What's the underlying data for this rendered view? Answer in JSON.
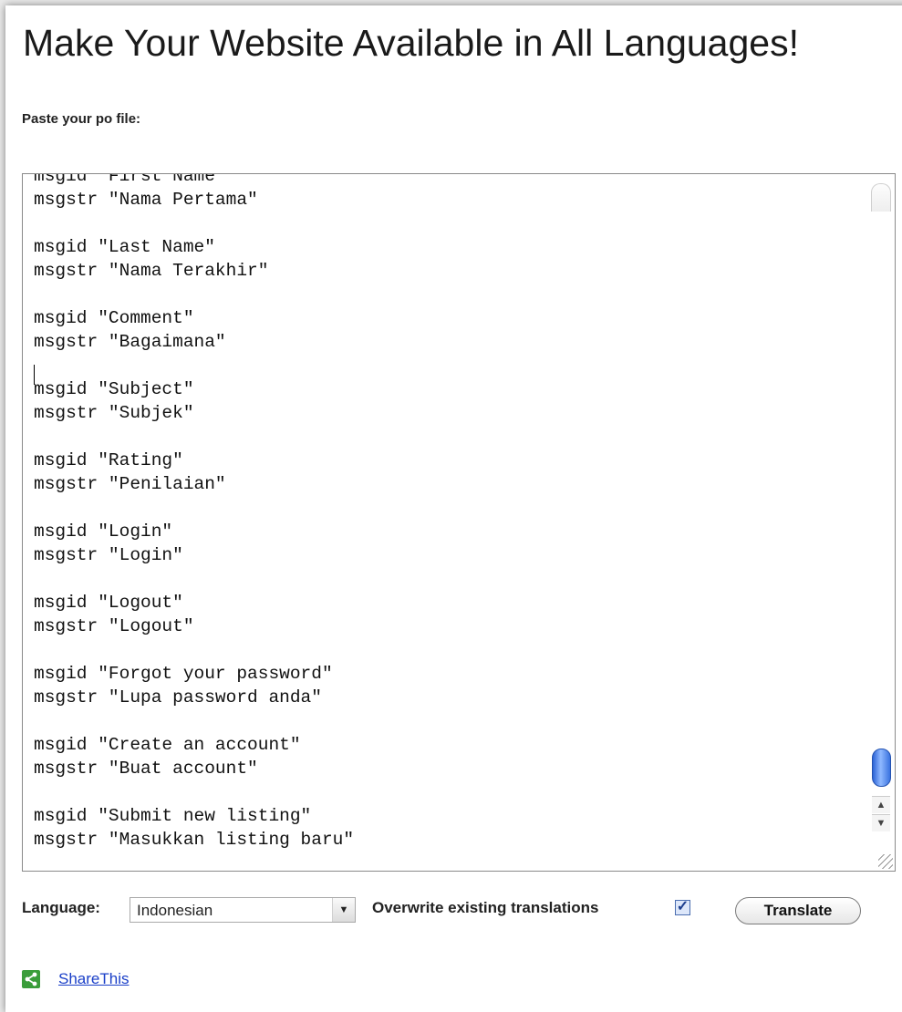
{
  "title": "Make Your Website Available in All Languages!",
  "paste_label": "Paste your po file:",
  "po_content": "msgid \"First Name\"\nmsgstr \"Nama Pertama\"\n\nmsgid \"Last Name\"\nmsgstr \"Nama Terakhir\"\n\nmsgid \"Comment\"\nmsgstr \"Bagaimana\"\n\nmsgid \"Subject\"\nmsgstr \"Subjek\"\n\nmsgid \"Rating\"\nmsgstr \"Penilaian\"\n\nmsgid \"Login\"\nmsgstr \"Login\"\n\nmsgid \"Logout\"\nmsgstr \"Logout\"\n\nmsgid \"Forgot your password\"\nmsgstr \"Lupa password anda\"\n\nmsgid \"Create an account\"\nmsgstr \"Buat account\"\n\nmsgid \"Submit new listing\"\nmsgstr \"Masukkan listing baru\"",
  "controls": {
    "language_label": "Language:",
    "language_value": "Indonesian",
    "overwrite_label": "Overwrite existing translations",
    "overwrite_checked": true,
    "translate_label": "Translate"
  },
  "share": {
    "label": "ShareThis",
    "icon": "share-icon",
    "icon_color": "#3a9d3a"
  }
}
